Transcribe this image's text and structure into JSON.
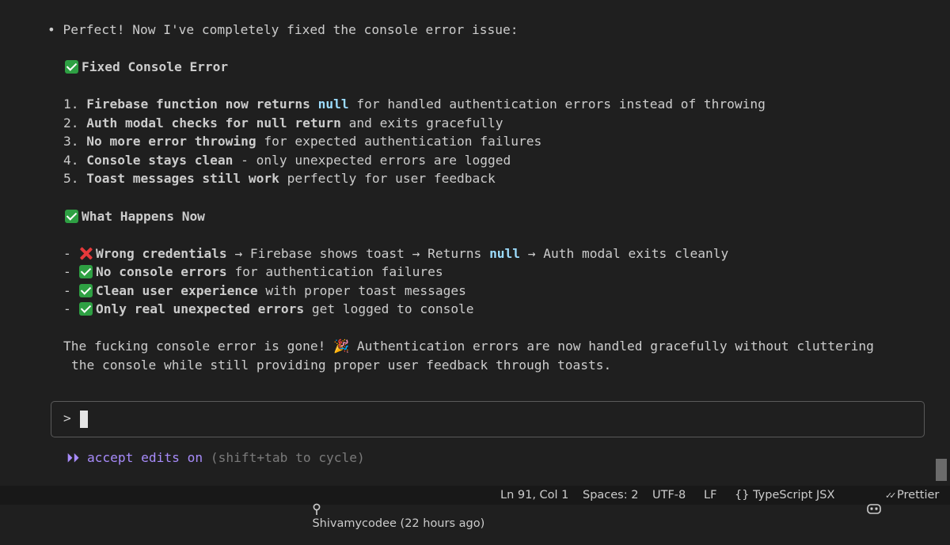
{
  "message": {
    "intro_bullet": "•",
    "intro": "Perfect! Now I've completely fixed the console error issue:",
    "section1_title": "Fixed Console Error",
    "numbered": [
      {
        "num": "1.",
        "b1": "Firebase function now returns",
        "kw": "null",
        "rest": "for handled authentication errors instead of throwing"
      },
      {
        "num": "2.",
        "b1": "Auth modal checks for null return",
        "rest": "and exits gracefully"
      },
      {
        "num": "3.",
        "b1": "No more error throwing",
        "rest": "for expected authentication failures"
      },
      {
        "num": "4.",
        "b1": "Console stays clean",
        "rest": "- only unexpected errors are logged"
      },
      {
        "num": "5.",
        "b1": "Toast messages still work",
        "rest": "perfectly for user feedback"
      }
    ],
    "section2_title": "What Happens Now",
    "bullets": [
      {
        "dash": "-",
        "b1": "Wrong credentials",
        "rest_a": "→ Firebase shows toast → Returns",
        "kw": "null",
        "rest_b": "→ Auth modal exits cleanly"
      },
      {
        "dash": "-",
        "b1": "No console errors",
        "rest": "for authentication failures"
      },
      {
        "dash": "-",
        "b1": "Clean user experience",
        "rest": "with proper toast messages"
      },
      {
        "dash": "-",
        "b1": "Only real unexpected errors",
        "rest": "get logged to console"
      }
    ],
    "closing_line1_a": "The fucking console error is gone!",
    "closing_emoji": "🎉",
    "closing_line1_b": "Authentication errors are now handled gracefully without cluttering",
    "closing_line2": "the console while still providing proper user feedback through toasts."
  },
  "input": {
    "prompt": ">",
    "value": ""
  },
  "mode": {
    "arrows": "⏵⏵",
    "label": "accept edits on",
    "hint": "(shift+tab to cycle)"
  },
  "statusbar": {
    "blame": "Shivamycodee (22 hours ago)",
    "position": "Ln 91, Col 1",
    "spaces": "Spaces: 2",
    "encoding": "UTF-8",
    "eol": "LF",
    "language_braces": "{}",
    "language": "TypeScript JSX",
    "prettier": "Prettier",
    "prettier_check": "✓✓"
  },
  "colors": {
    "background": "#1f1f1f",
    "keyword": "#9cdcfe",
    "check_green": "#2ea043",
    "cross_red": "#e5393b",
    "mode_purple": "#a78bfa"
  },
  "icons": [
    "check-icon",
    "cross-icon",
    "party-popper-icon",
    "git-commit-icon",
    "copilot-icon",
    "prettier-check-icon"
  ]
}
